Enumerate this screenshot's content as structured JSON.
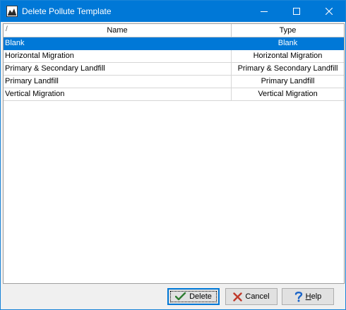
{
  "window": {
    "title": "Delete Pollute Template"
  },
  "grid": {
    "sort_marker": "/",
    "columns": [
      "Name",
      "Type"
    ],
    "rows": [
      {
        "name": "Blank",
        "type": "Blank",
        "selected": true
      },
      {
        "name": "Horizontal Migration",
        "type": "Horizontal Migration",
        "selected": false
      },
      {
        "name": "Primary & Secondary Landfill",
        "type": "Primary & Secondary Landfill",
        "selected": false
      },
      {
        "name": "Primary Landfill",
        "type": "Primary Landfill",
        "selected": false
      },
      {
        "name": "Vertical Migration",
        "type": "Vertical Migration",
        "selected": false
      }
    ]
  },
  "buttons": {
    "delete_label": "Delete",
    "cancel_label": "Cancel",
    "help_prefix": "",
    "help_mnemonic": "H",
    "help_rest": "elp"
  },
  "icons": {
    "app": "app-icon",
    "delete": "checkmark-icon",
    "cancel": "x-icon",
    "help": "question-mark-icon"
  },
  "colors": {
    "titlebar": "#0078d7",
    "selection": "#0078d7",
    "cancel_icon": "#c0392b",
    "help_icon": "#1a64c8",
    "delete_icon": "#2e7d32"
  }
}
